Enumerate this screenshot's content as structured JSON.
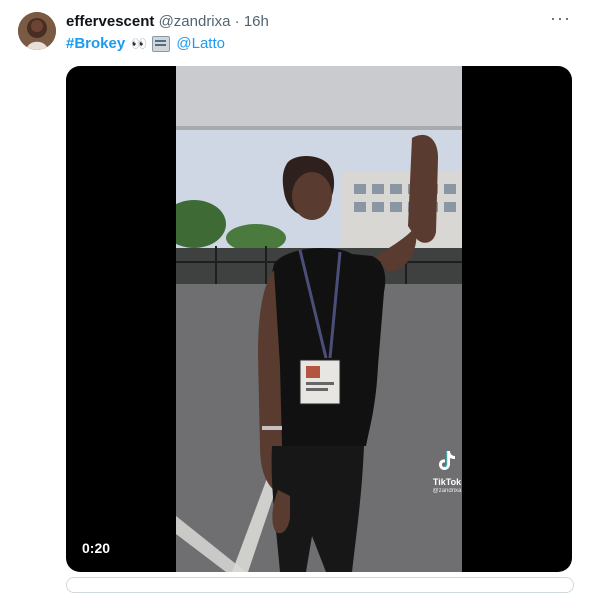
{
  "tweet": {
    "display_name": "effervescent",
    "handle": "@zandrixa",
    "separator": "·",
    "time": "16h",
    "more_icon": "more-icon",
    "hashtag": "#Brokey",
    "eyes_emoji": "👀",
    "news_emoji": "newspaper-icon",
    "mention": "@Latto"
  },
  "media": {
    "duration": "0:20",
    "tiktok_label": "TikTok",
    "tiktok_handle": "@zandrixa",
    "colors": {
      "bars": "#000000",
      "sky": "#cfd7e4",
      "asphalt": "#6c6c6e",
      "shirt": "#111111",
      "skin": "#5a3b2f"
    }
  }
}
